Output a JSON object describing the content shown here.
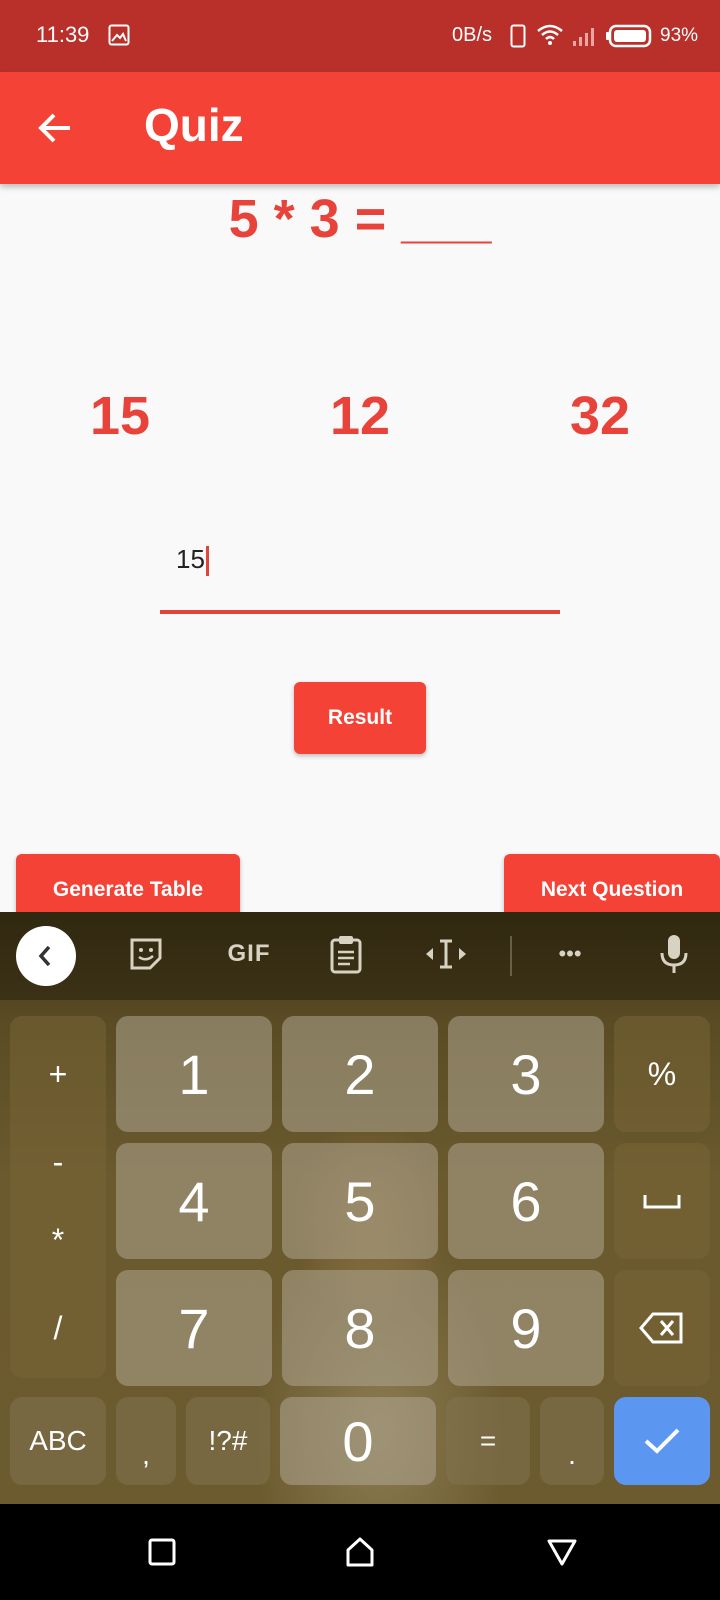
{
  "status_bar": {
    "time": "11:39",
    "net_speed": "0B/s",
    "battery": "93%",
    "icons": [
      "image-icon",
      "phone-icon",
      "wifi-icon",
      "signal-icon",
      "battery-icon"
    ]
  },
  "app_bar": {
    "title": "Quiz",
    "back_icon": "arrow-left-icon",
    "color": "#f44336"
  },
  "quiz": {
    "question": "5 * 3 = ___",
    "options": [
      "15",
      "12",
      "32"
    ],
    "answer_value": "15",
    "result_label": "Result",
    "generate_label": "Generate Table",
    "next_label": "Next Question",
    "accent_color": "#e8433a"
  },
  "keyboard": {
    "toolbar": [
      "chevron-left-icon",
      "sticker-icon",
      "GIF",
      "clipboard-icon",
      "text-cursor-icon",
      "more-icon",
      "mic-icon"
    ],
    "gif_label": "GIF",
    "more_label": "•••",
    "side_keys": [
      "+",
      "-",
      "*",
      "/"
    ],
    "digits": [
      "1",
      "2",
      "3",
      "4",
      "5",
      "6",
      "7",
      "8",
      "9",
      "0"
    ],
    "percent": "%",
    "abc": "ABC",
    "comma": ",",
    "symbols": "!?#",
    "equals": "=",
    "period": "."
  },
  "nav_bar": {
    "icons": [
      "recent-apps-icon",
      "home-icon",
      "back-icon"
    ]
  }
}
